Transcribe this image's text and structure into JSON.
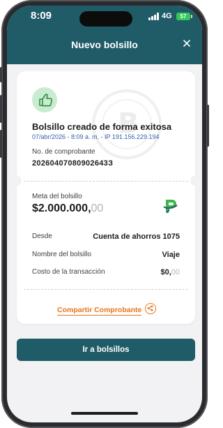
{
  "status_bar": {
    "time": "8:09",
    "network": "4G",
    "battery": "57"
  },
  "header": {
    "title": "Nuevo bolsillo",
    "close_icon": "close-icon"
  },
  "receipt": {
    "success_icon": "thumbs-up-icon",
    "title": "Bolsillo creado de forma exitosa",
    "meta": "07/abr/2026 - 8:09 a. m. - IP 191.156.229.194",
    "receipt_label": "No. de comprobante",
    "receipt_number": "20260407080902643З",
    "goal_label": "Meta del bolsillo",
    "goal_amount_int": "$2.000.000,",
    "goal_amount_dec": "00",
    "rows": [
      {
        "label": "Desde",
        "value": "Cuenta de ahorros 1075"
      },
      {
        "label": "Nombre del bolsillo",
        "value": "Viaje"
      },
      {
        "label": "Costo de la transacción",
        "value_int": "$0,",
        "value_dec": "00"
      }
    ],
    "share_label": "Compartir Comprobante",
    "share_icon": "share-icon"
  },
  "primary_button": {
    "label": "Ir a bolsillos"
  },
  "colors": {
    "brand": "#1f5c68",
    "accent": "#e8751a",
    "success_bg": "#c9ecd0",
    "meta": "#2f5fa8"
  }
}
